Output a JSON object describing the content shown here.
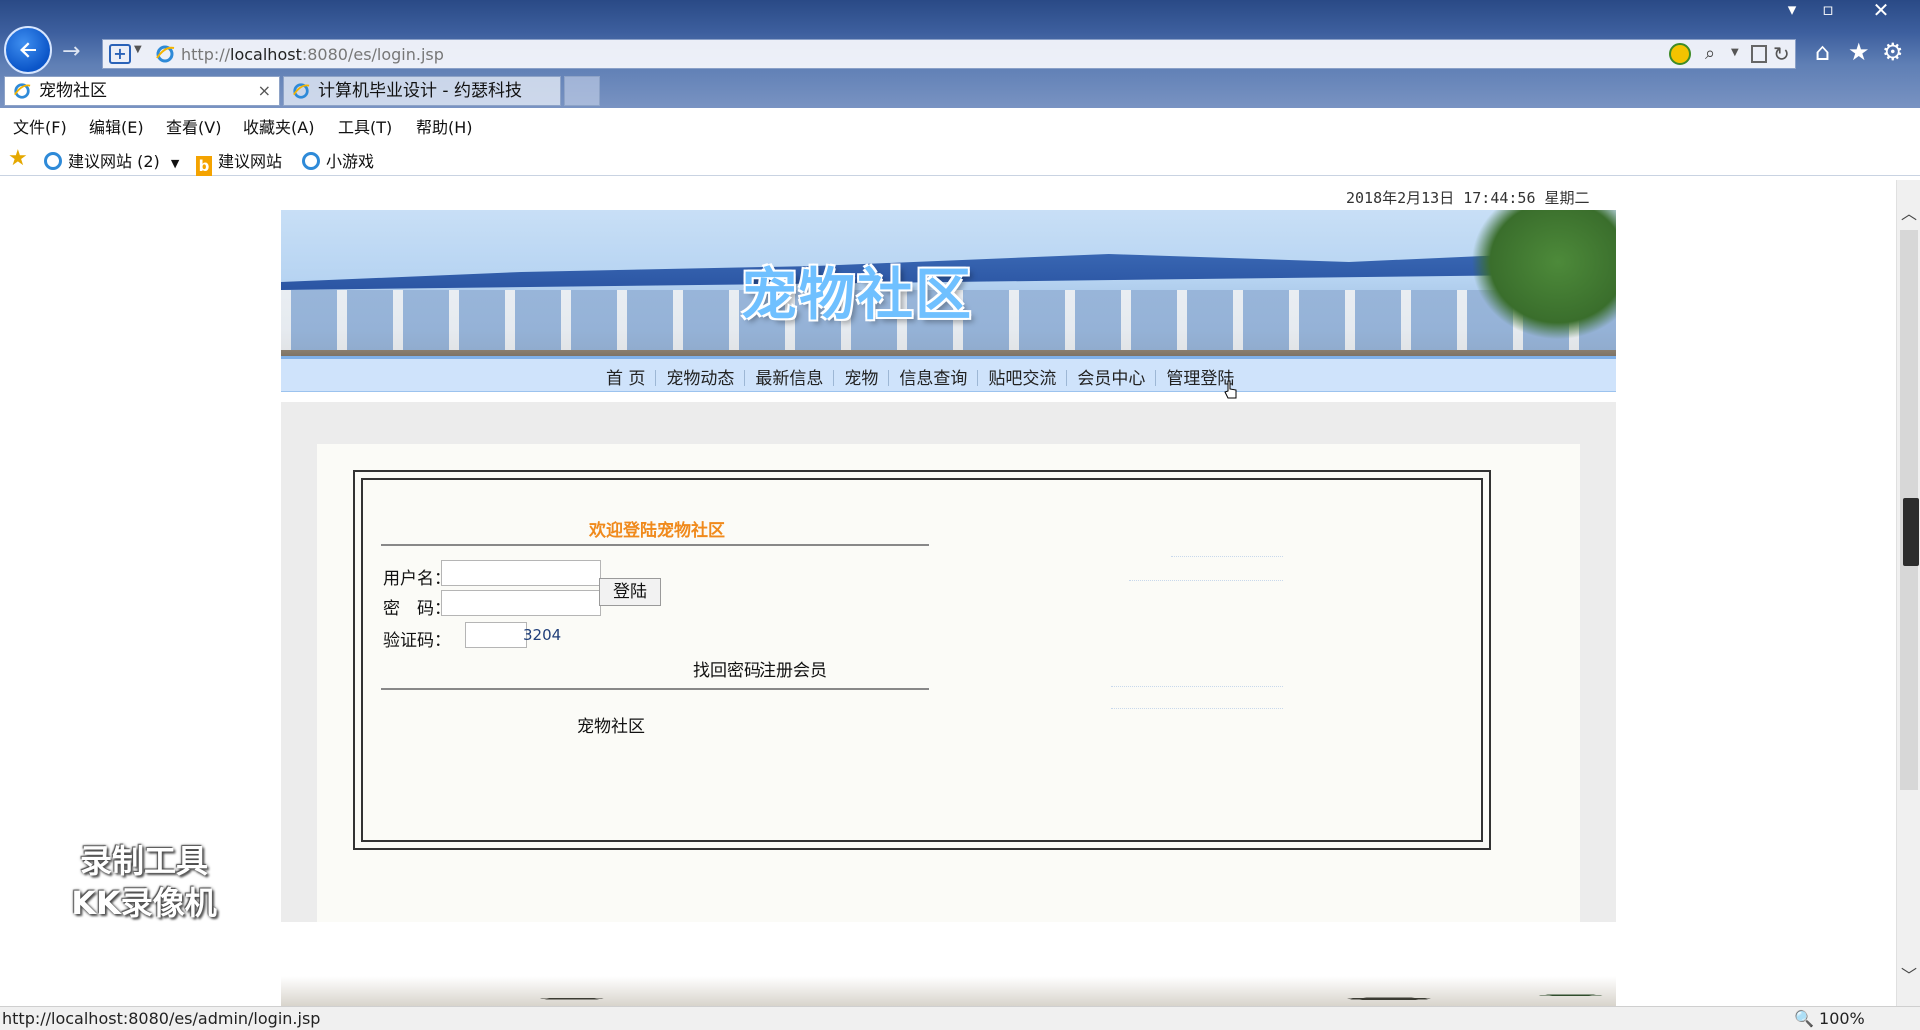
{
  "window": {
    "minimize": "▾",
    "restore": "▫",
    "close": "✕"
  },
  "address": {
    "url_prefix": "http://",
    "url_host": "localhost",
    "url_rest": ":8080/es/login.jsp"
  },
  "tabs": [
    {
      "label": "宠物社区",
      "active": true,
      "close": "×"
    },
    {
      "label": "计算机毕业设计 - 约瑟科技",
      "active": false
    }
  ],
  "menu": [
    "文件(F)",
    "编辑(E)",
    "查看(V)",
    "收藏夹(A)",
    "工具(T)",
    "帮助(H)"
  ],
  "favorites": {
    "items": [
      {
        "label": "建议网站 (2)",
        "icon": "ie-icon"
      },
      {
        "label": "建议网站",
        "icon": "bing-icon"
      },
      {
        "label": "小游戏",
        "icon": "ie-icon"
      }
    ]
  },
  "site": {
    "datetime": "2018年2月13日 17:44:56 星期二",
    "banner_title": "宠物社区",
    "nav": [
      "首 页",
      "宠物动态",
      "最新信息",
      "宠物",
      "信息查询",
      "贴吧交流",
      "会员中心",
      "管理登陆"
    ],
    "login": {
      "welcome": "欢迎登陆宠物社区",
      "username_label": "用户名：",
      "password_label": "密　码：",
      "captcha_label": "验证码：",
      "username_value": "",
      "password_value": "",
      "captcha_input_value": "",
      "captcha_code": "3204",
      "submit": "登陆",
      "find_password": "找回密码",
      "register": "注册会员",
      "footer_name": "宠物社区"
    }
  },
  "watermark": {
    "line1": "录制工具",
    "line2": "KK录像机"
  },
  "status": {
    "url": "http://localhost:8080/es/admin/login.jsp",
    "zoom": "100%"
  },
  "colors": {
    "accent": "#f08a1c",
    "nav_bg": "#cfe3fb",
    "chrome": "#3d5f9e"
  }
}
